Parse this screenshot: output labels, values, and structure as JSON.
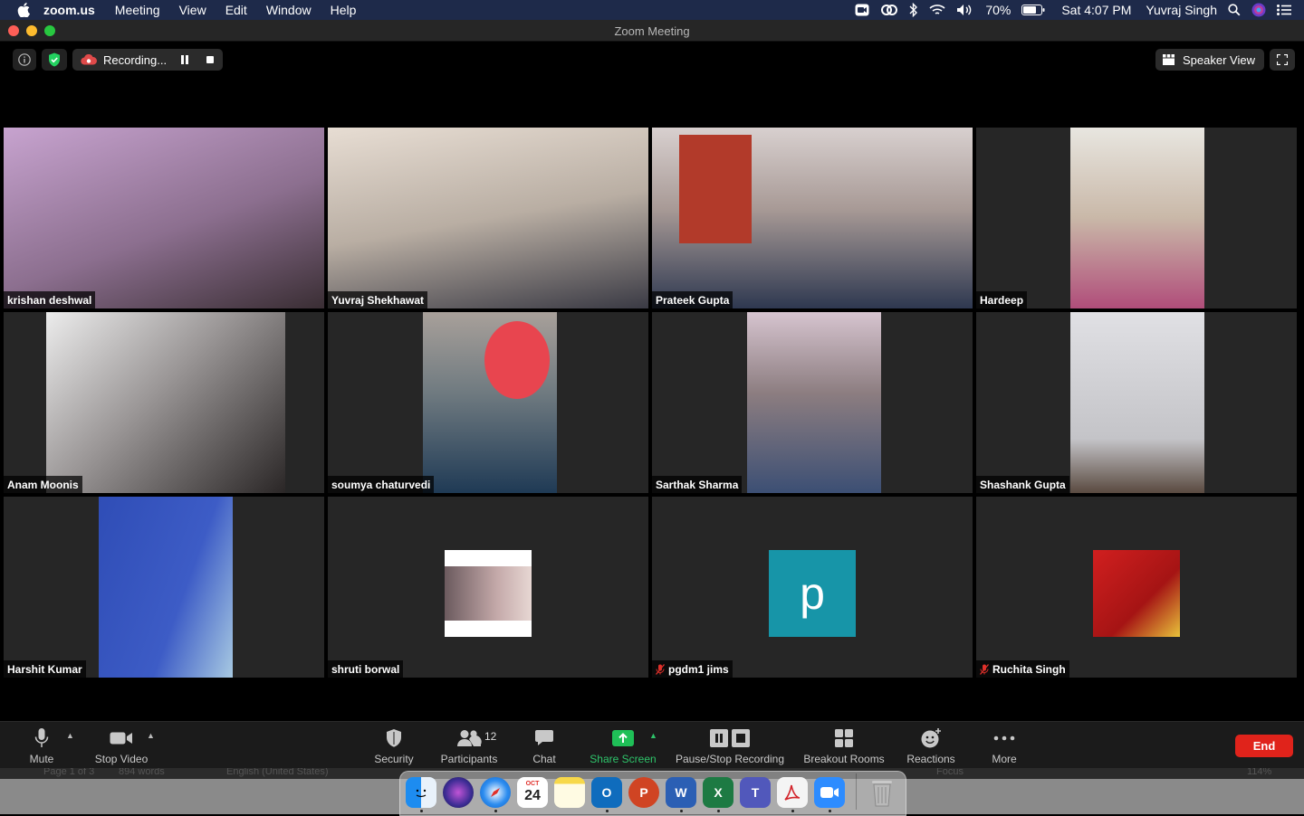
{
  "menubar": {
    "app_name": "zoom.us",
    "items": [
      "Meeting",
      "View",
      "Edit",
      "Window",
      "Help"
    ],
    "battery": "70%",
    "clock": "Sat 4:07 PM",
    "user": "Yuvraj Singh"
  },
  "window": {
    "title": "Zoom Meeting"
  },
  "top": {
    "recording_label": "Recording...",
    "speaker_view_label": "Speaker View"
  },
  "participants": [
    {
      "name": "krishan deshwal",
      "muted": false,
      "active": true,
      "color": "#6a5a63"
    },
    {
      "name": "Yuvraj Shekhawat",
      "muted": false,
      "active": false,
      "color": "#7f756b"
    },
    {
      "name": "Prateek Gupta",
      "muted": false,
      "active": false,
      "color": "#817b78"
    },
    {
      "name": "Hardeep",
      "muted": false,
      "active": false,
      "color": "#9a8e83"
    },
    {
      "name": "Anam Moonis",
      "muted": false,
      "active": false,
      "color": "#5e5858"
    },
    {
      "name": "soumya chaturvedi",
      "muted": false,
      "active": false,
      "color": "#5a6570"
    },
    {
      "name": "Sarthak Sharma",
      "muted": false,
      "active": false,
      "color": "#9a8f98"
    },
    {
      "name": "Shashank Gupta",
      "muted": false,
      "active": false,
      "color": "#c8c8cc"
    },
    {
      "name": "Harshit Kumar",
      "muted": false,
      "active": false,
      "color": "#3d57b8"
    },
    {
      "name": "shruti borwal",
      "muted": false,
      "active": false,
      "color": "#8f7d80"
    },
    {
      "name": "pgdm1 jims",
      "muted": true,
      "active": false,
      "avatar_letter": "p",
      "color": "#1795a8"
    },
    {
      "name": "Ruchita Singh",
      "muted": true,
      "active": false,
      "color": "#c21d1d"
    }
  ],
  "toolbar": {
    "mute": "Mute",
    "stop_video": "Stop Video",
    "security": "Security",
    "participants": "Participants",
    "participant_count": "12",
    "chat": "Chat",
    "share_screen": "Share Screen",
    "recording": "Pause/Stop Recording",
    "breakout": "Breakout Rooms",
    "reactions": "Reactions",
    "more": "More",
    "end": "End"
  },
  "wordbar": {
    "page": "Page 1 of 3",
    "words": "894 words",
    "language": "English (United States)",
    "focus": "Focus",
    "zoom": "114%"
  },
  "dock": {
    "calendar_month": "OCT",
    "calendar_day": "24"
  }
}
